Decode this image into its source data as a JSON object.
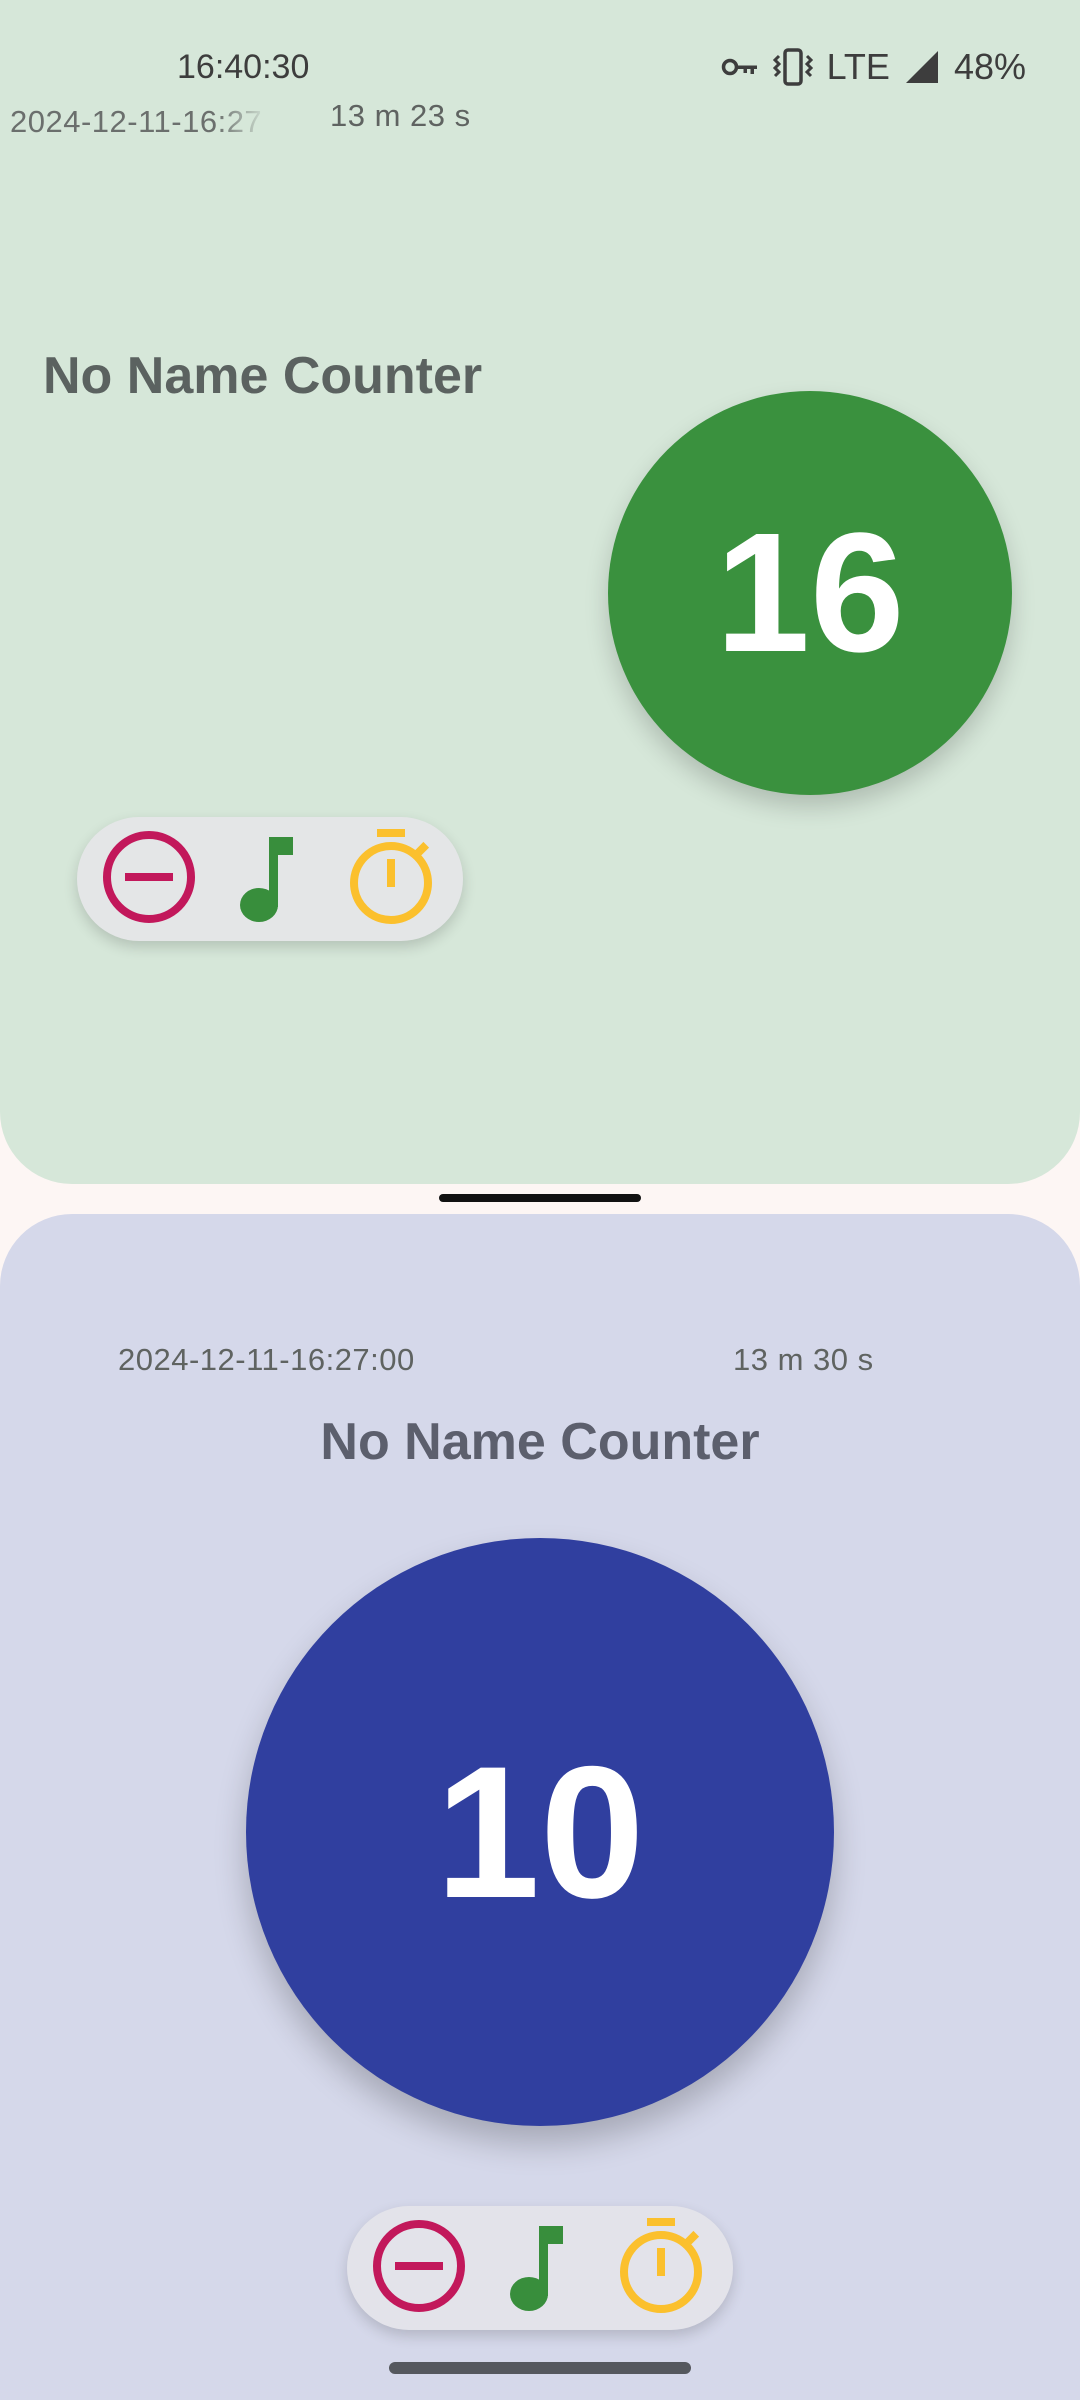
{
  "status_bar": {
    "time": "16:40:30",
    "network": "LTE",
    "battery": "48%"
  },
  "top_counter": {
    "date": "2024-12-11-16:27",
    "elapsed": "13 m 23 s",
    "name": "No Name Counter",
    "count": "16",
    "color": "#3A913E",
    "background": "#D6E7D9"
  },
  "bottom_counter": {
    "date": "2024-12-11-16:27:00",
    "elapsed": "13 m 30 s",
    "name": "No Name Counter",
    "count": "10",
    "color": "#303F9F",
    "background": "#D5D8EA"
  },
  "toolbar_icons": [
    "minus-circle-icon",
    "music-note-icon",
    "stopwatch-icon"
  ],
  "colors": {
    "decrement": "#C2185B",
    "sound": "#388E3C",
    "timer": "#FBC02D"
  }
}
